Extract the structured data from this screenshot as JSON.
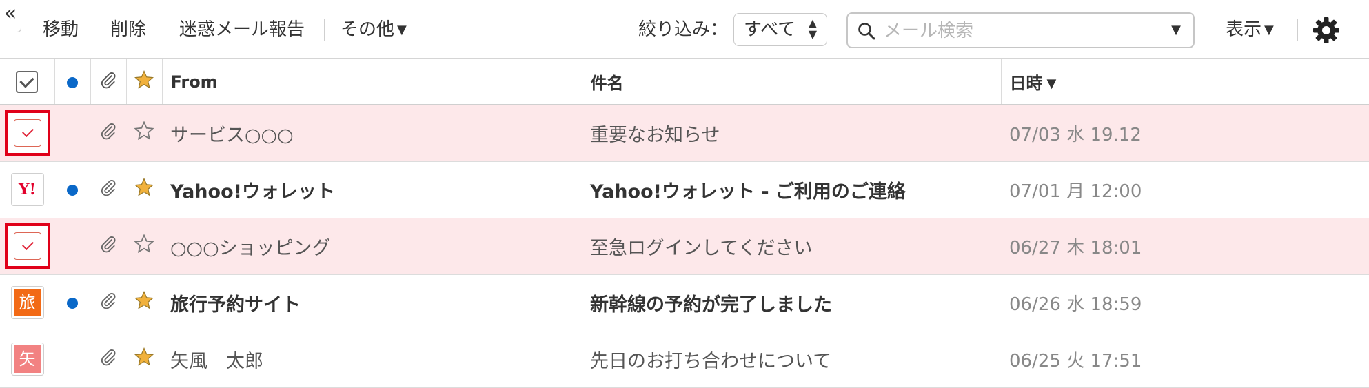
{
  "toolbar": {
    "collapse_glyph": "«",
    "move": "移動",
    "delete": "削除",
    "spam_report": "迷惑メール報告",
    "more": "その他",
    "filter_label": "絞り込み：",
    "filter_value": "すべて",
    "search_placeholder": "メール検索",
    "view": "表示"
  },
  "table": {
    "headers": {
      "from": "From",
      "subject": "件名",
      "date": "日時"
    },
    "rows": [
      {
        "checked": true,
        "avatar": "",
        "unread": false,
        "starred": false,
        "from": "サービス○○○",
        "subject": "重要なお知らせ",
        "date": "07/03 水 19.12"
      },
      {
        "checked": false,
        "avatar": "Y!",
        "unread": true,
        "starred": true,
        "from": "Yahoo!ウォレット",
        "subject": "Yahoo!ウォレット - ご利用のご連絡",
        "date": "07/01 月 12:00"
      },
      {
        "checked": true,
        "avatar": "",
        "unread": false,
        "starred": false,
        "from": "○○○ショッピング",
        "subject": "至急ログインしてください",
        "date": "06/27 木 18:01"
      },
      {
        "checked": false,
        "avatar": "旅",
        "unread": true,
        "starred": true,
        "from": "旅行予約サイト",
        "subject": "新幹線の予約が完了しました",
        "date": "06/26 水 18:59"
      },
      {
        "checked": false,
        "avatar": "矢",
        "unread": false,
        "starred": true,
        "from": "矢風　太郎",
        "subject": "先日のお打ち合わせについて",
        "date": "06/25 火 17:51"
      }
    ]
  },
  "colors": {
    "unread_dot": "#0a68c8",
    "flag_bg": "#fde8ea",
    "highlight": "#e00019",
    "star_fill": "#f1b13c"
  }
}
